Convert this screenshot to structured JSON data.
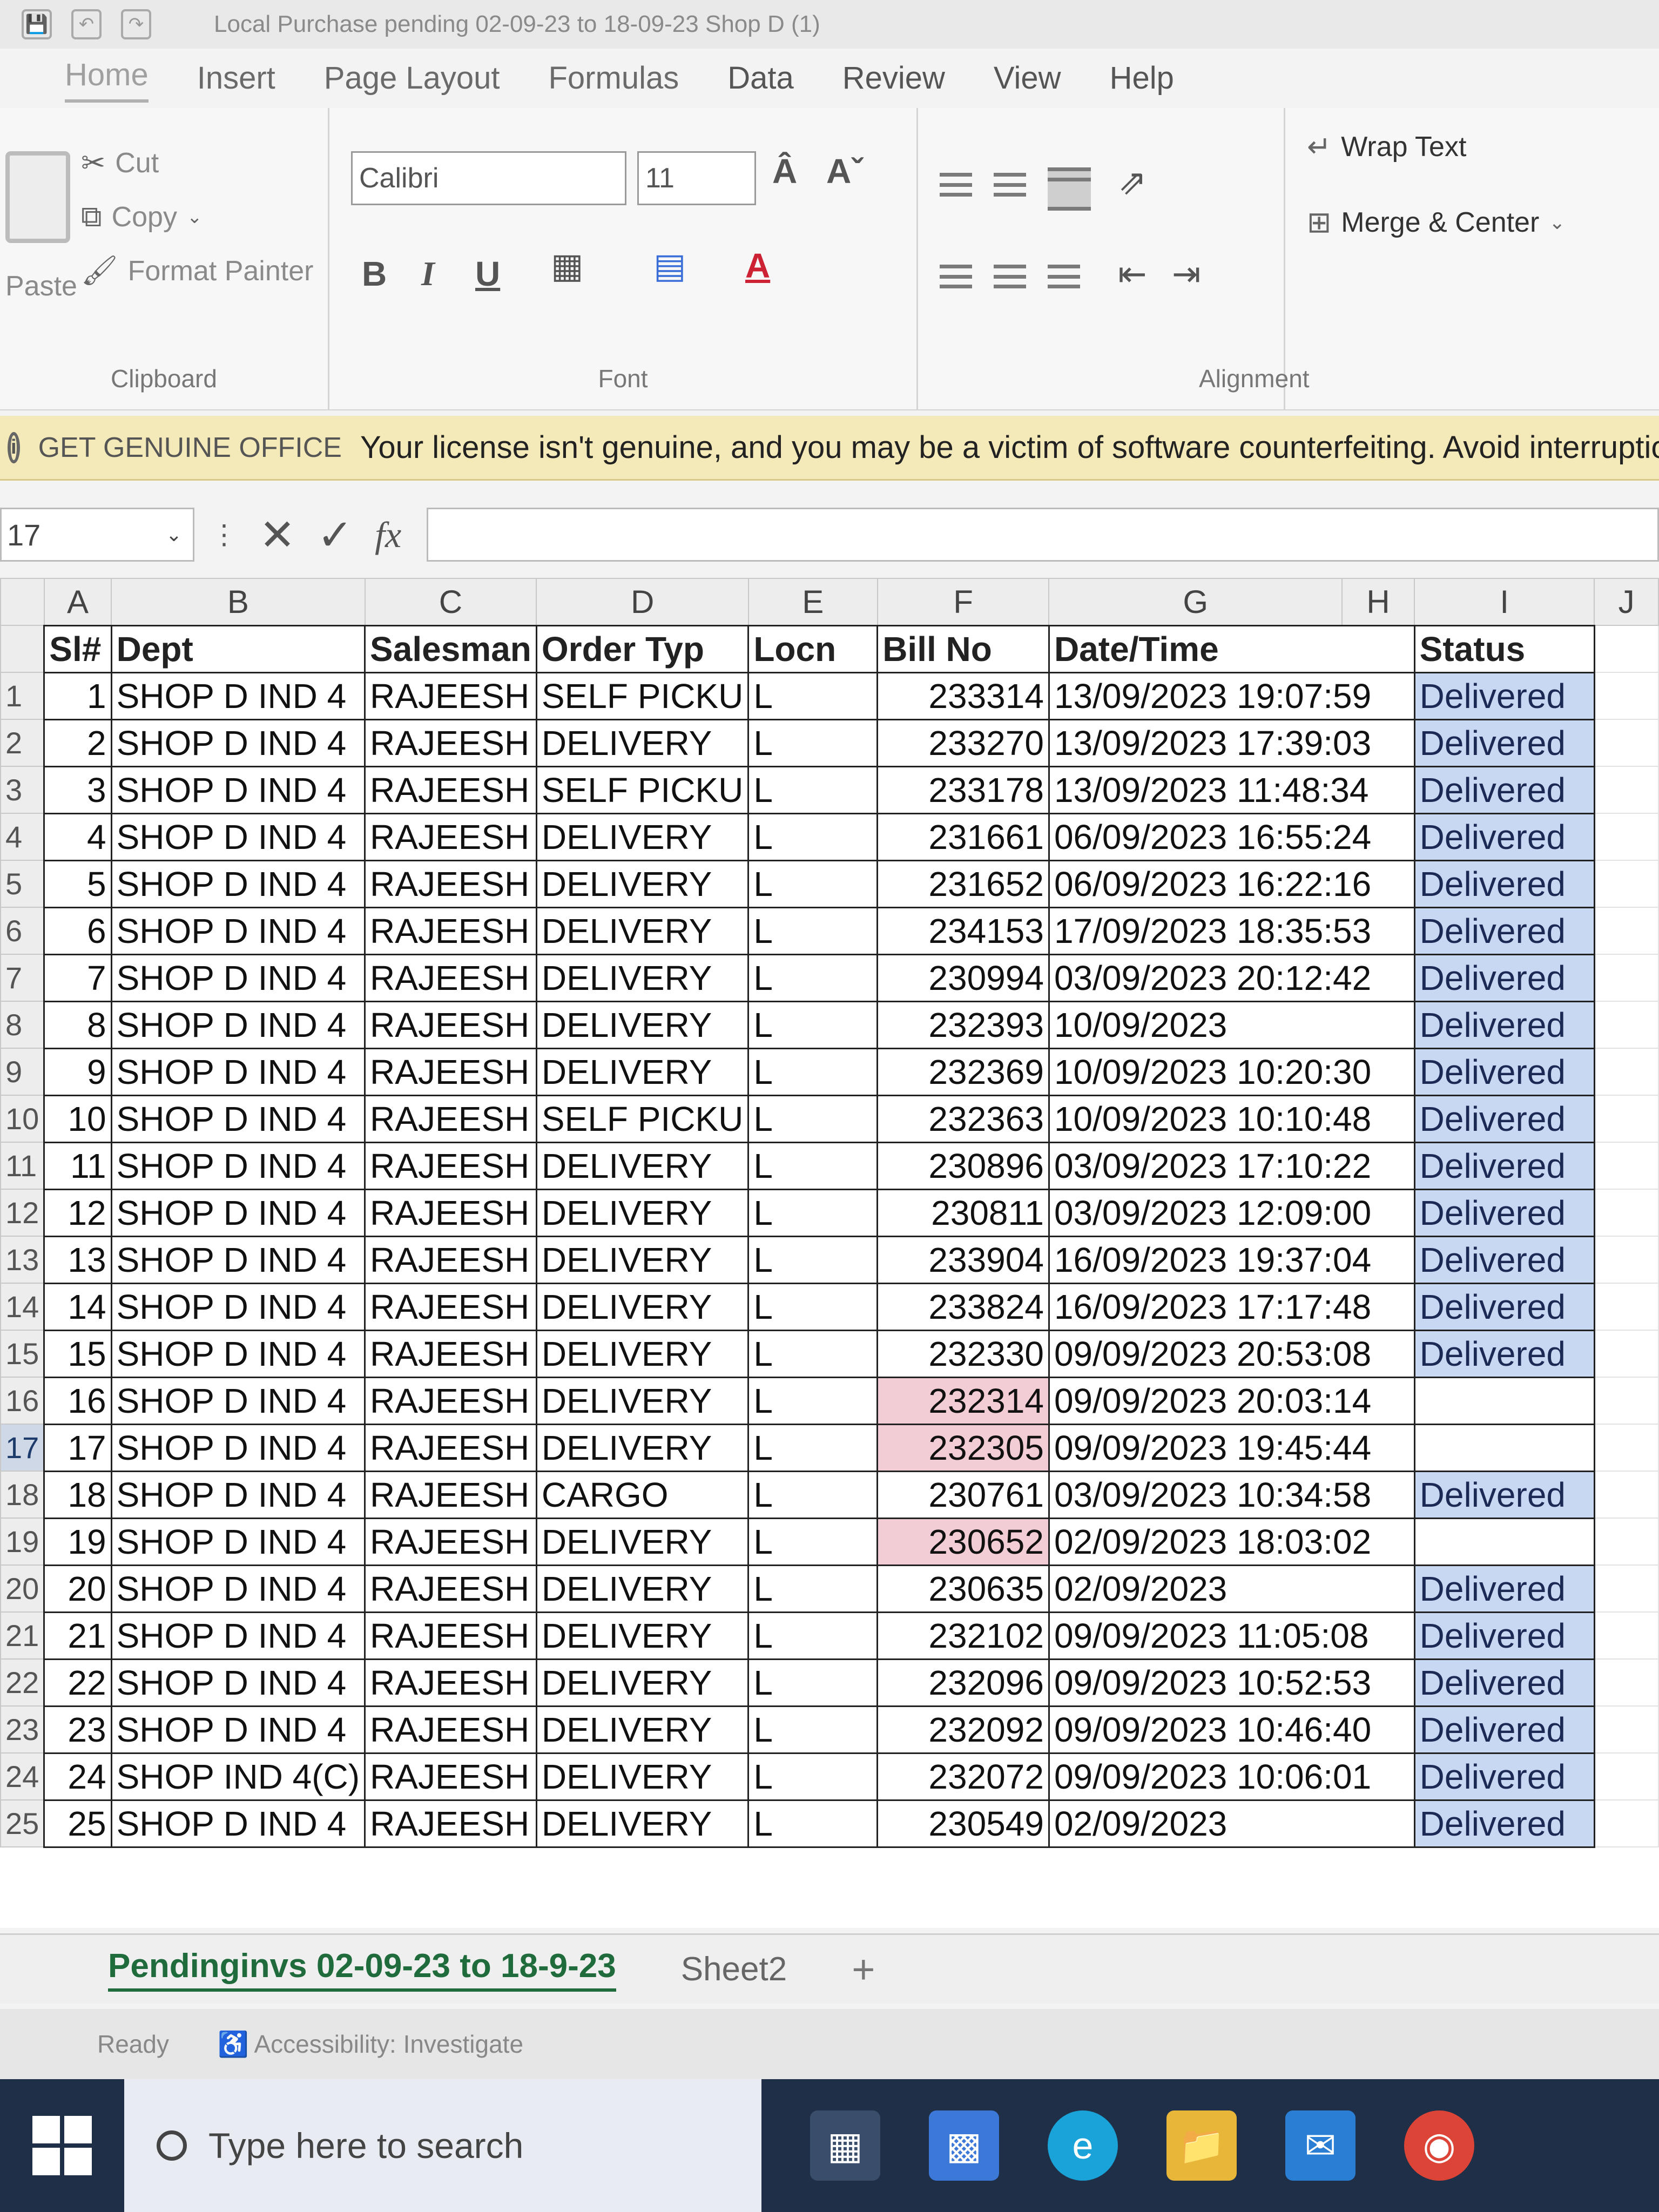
{
  "window": {
    "title": "Local Purchase pending 02-09-23 to 18-09-23 Shop D (1)"
  },
  "menu": {
    "tabs": [
      "Home",
      "Insert",
      "Page Layout",
      "Formulas",
      "Data",
      "Review",
      "View",
      "Help"
    ]
  },
  "ribbon": {
    "clipboard": {
      "paste": "Paste",
      "cut": "Cut",
      "copy": "Copy",
      "format_painter": "Format Painter",
      "label": "Clipboard"
    },
    "font": {
      "name": "Calibri",
      "size": "11",
      "bold": "B",
      "italic": "I",
      "underline": "U",
      "label": "Font"
    },
    "alignment": {
      "label": "Alignment"
    },
    "wrap": {
      "wrap_text": "Wrap Text",
      "merge_center": "Merge & Center"
    }
  },
  "banner": {
    "brand": "GET GENUINE OFFICE",
    "message": "Your license isn't genuine, and you may be a victim of software counterfeiting. Avoid interruption a"
  },
  "formula_bar": {
    "name_box": "17",
    "fx": "fx",
    "value": ""
  },
  "sheet": {
    "columns": [
      "A",
      "B",
      "C",
      "D",
      "E",
      "F",
      "G",
      "H",
      "I",
      "J"
    ],
    "headers": [
      "Sl#",
      "Dept",
      "Salesman",
      "Order Typ",
      "Locn",
      "Bill No",
      "Date/Time",
      "Status"
    ],
    "rows": [
      {
        "row": "1",
        "sl": "1",
        "dept": "SHOP  D IND 4",
        "salesman": "RAJEESH",
        "order": "SELF PICKU",
        "locn": "L",
        "bill": "233314",
        "date": "13/09/2023 19:07:59",
        "status": "Delivered",
        "pink": false
      },
      {
        "row": "2",
        "sl": "2",
        "dept": "SHOP  D IND 4",
        "salesman": "RAJEESH",
        "order": "DELIVERY",
        "locn": "L",
        "bill": "233270",
        "date": "13/09/2023 17:39:03",
        "status": "Delivered",
        "pink": false
      },
      {
        "row": "3",
        "sl": "3",
        "dept": "SHOP  D IND 4",
        "salesman": "RAJEESH",
        "order": "SELF PICKU",
        "locn": "L",
        "bill": "233178",
        "date": "13/09/2023 11:48:34",
        "status": "Delivered",
        "pink": false
      },
      {
        "row": "4",
        "sl": "4",
        "dept": "SHOP  D IND 4",
        "salesman": "RAJEESH",
        "order": "DELIVERY",
        "locn": "L",
        "bill": "231661",
        "date": "06/09/2023 16:55:24",
        "status": "Delivered",
        "pink": false
      },
      {
        "row": "5",
        "sl": "5",
        "dept": "SHOP  D IND 4",
        "salesman": "RAJEESH",
        "order": "DELIVERY",
        "locn": "L",
        "bill": "231652",
        "date": "06/09/2023 16:22:16",
        "status": "Delivered",
        "pink": false
      },
      {
        "row": "6",
        "sl": "6",
        "dept": "SHOP  D IND 4",
        "salesman": "RAJEESH",
        "order": "DELIVERY",
        "locn": "L",
        "bill": "234153",
        "date": "17/09/2023 18:35:53",
        "status": "Delivered",
        "pink": false
      },
      {
        "row": "7",
        "sl": "7",
        "dept": "SHOP  D IND 4",
        "salesman": "RAJEESH",
        "order": "DELIVERY",
        "locn": "L",
        "bill": "230994",
        "date": "03/09/2023 20:12:42",
        "status": "Delivered",
        "pink": false
      },
      {
        "row": "8",
        "sl": "8",
        "dept": "SHOP  D IND 4",
        "salesman": "RAJEESH",
        "order": "DELIVERY",
        "locn": "L",
        "bill": "232393",
        "date": "10/09/2023",
        "status": "Delivered",
        "pink": false
      },
      {
        "row": "9",
        "sl": "9",
        "dept": "SHOP  D IND 4",
        "salesman": "RAJEESH",
        "order": "DELIVERY",
        "locn": "L",
        "bill": "232369",
        "date": "10/09/2023 10:20:30",
        "status": "Delivered",
        "pink": false
      },
      {
        "row": "10",
        "sl": "10",
        "dept": "SHOP  D IND 4",
        "salesman": "RAJEESH",
        "order": "SELF PICKU",
        "locn": "L",
        "bill": "232363",
        "date": "10/09/2023 10:10:48",
        "status": "Delivered",
        "pink": false
      },
      {
        "row": "11",
        "sl": "11",
        "dept": "SHOP  D IND 4",
        "salesman": "RAJEESH",
        "order": "DELIVERY",
        "locn": "L",
        "bill": "230896",
        "date": "03/09/2023 17:10:22",
        "status": "Delivered",
        "pink": false
      },
      {
        "row": "12",
        "sl": "12",
        "dept": "SHOP  D IND 4",
        "salesman": "RAJEESH",
        "order": "DELIVERY",
        "locn": "L",
        "bill": "230811",
        "date": "03/09/2023 12:09:00",
        "status": "Delivered",
        "pink": false
      },
      {
        "row": "13",
        "sl": "13",
        "dept": "SHOP  D IND 4",
        "salesman": "RAJEESH",
        "order": "DELIVERY",
        "locn": "L",
        "bill": "233904",
        "date": "16/09/2023 19:37:04",
        "status": "Delivered",
        "pink": false
      },
      {
        "row": "14",
        "sl": "14",
        "dept": "SHOP  D IND 4",
        "salesman": "RAJEESH",
        "order": "DELIVERY",
        "locn": "L",
        "bill": "233824",
        "date": "16/09/2023 17:17:48",
        "status": "Delivered",
        "pink": false
      },
      {
        "row": "15",
        "sl": "15",
        "dept": "SHOP  D IND 4",
        "salesman": "RAJEESH",
        "order": "DELIVERY",
        "locn": "L",
        "bill": "232330",
        "date": "09/09/2023 20:53:08",
        "status": "Delivered",
        "pink": false
      },
      {
        "row": "16",
        "sl": "16",
        "dept": "SHOP  D IND 4",
        "salesman": "RAJEESH",
        "order": "DELIVERY",
        "locn": "L",
        "bill": "232314",
        "date": "09/09/2023 20:03:14",
        "status": "",
        "pink": true
      },
      {
        "row": "17",
        "sl": "17",
        "dept": "SHOP  D IND 4",
        "salesman": "RAJEESH",
        "order": "DELIVERY",
        "locn": "L",
        "bill": "232305",
        "date": "09/09/2023 19:45:44",
        "status": "",
        "pink": true
      },
      {
        "row": "18",
        "sl": "18",
        "dept": "SHOP  D IND 4",
        "salesman": "RAJEESH",
        "order": "CARGO",
        "locn": "L",
        "bill": "230761",
        "date": "03/09/2023 10:34:58",
        "status": "Delivered",
        "pink": false
      },
      {
        "row": "19",
        "sl": "19",
        "dept": "SHOP  D IND 4",
        "salesman": "RAJEESH",
        "order": "DELIVERY",
        "locn": "L",
        "bill": "230652",
        "date": "02/09/2023 18:03:02",
        "status": "",
        "pink": true
      },
      {
        "row": "20",
        "sl": "20",
        "dept": "SHOP  D IND 4",
        "salesman": "RAJEESH",
        "order": "DELIVERY",
        "locn": "L",
        "bill": "230635",
        "date": "02/09/2023",
        "status": "Delivered",
        "pink": false
      },
      {
        "row": "21",
        "sl": "21",
        "dept": "SHOP  D IND 4",
        "salesman": "RAJEESH",
        "order": "DELIVERY",
        "locn": "L",
        "bill": "232102",
        "date": "09/09/2023 11:05:08",
        "status": "Delivered",
        "pink": false
      },
      {
        "row": "22",
        "sl": "22",
        "dept": "SHOP  D IND 4",
        "salesman": "RAJEESH",
        "order": "DELIVERY",
        "locn": "L",
        "bill": "232096",
        "date": "09/09/2023 10:52:53",
        "status": "Delivered",
        "pink": false
      },
      {
        "row": "23",
        "sl": "23",
        "dept": "SHOP  D IND 4",
        "salesman": "RAJEESH",
        "order": "DELIVERY",
        "locn": "L",
        "bill": "232092",
        "date": "09/09/2023 10:46:40",
        "status": "Delivered",
        "pink": false
      },
      {
        "row": "24",
        "sl": "24",
        "dept": "SHOP IND 4(C)",
        "salesman": "RAJEESH",
        "order": "DELIVERY",
        "locn": "L",
        "bill": "232072",
        "date": "09/09/2023 10:06:01",
        "status": "Delivered",
        "pink": false
      },
      {
        "row": "25",
        "sl": "25",
        "dept": "SHOP  D IND 4",
        "salesman": "RAJEESH",
        "order": "DELIVERY",
        "locn": "L",
        "bill": "230549",
        "date": "02/09/2023",
        "status": "Delivered",
        "pink": false
      }
    ],
    "selected_row": "17"
  },
  "sheet_tabs": {
    "active": "Pendinginvs 02-09-23 to 18-9-23",
    "other": "Sheet2",
    "add": "+"
  },
  "statusbar": {
    "ready": "Ready",
    "accessibility": "Accessibility: Investigate"
  },
  "taskbar": {
    "search_placeholder": "Type here to search"
  }
}
